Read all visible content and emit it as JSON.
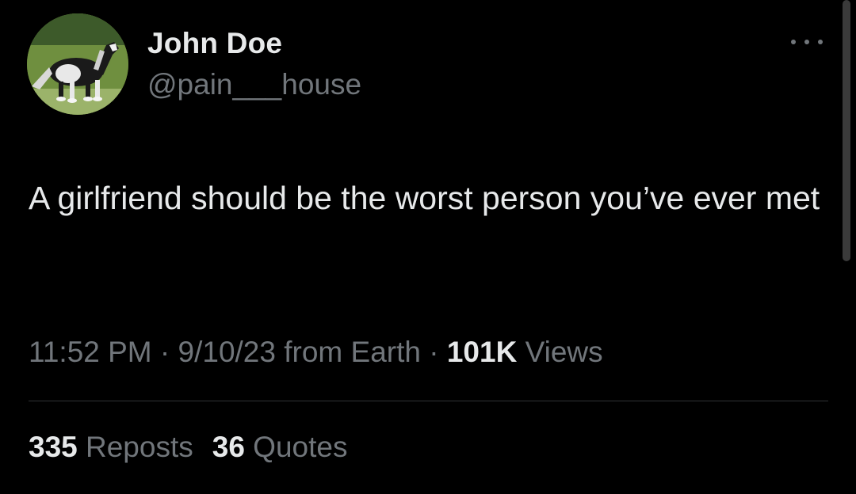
{
  "author": {
    "display_name": "John Doe",
    "handle": "@pain___house",
    "avatar_icon": "horse-avatar-icon"
  },
  "tweet": {
    "text": "A girlfriend should be the worst person you’ve ever met"
  },
  "meta": {
    "time": "11:52 PM",
    "separator1": " · ",
    "date": "9/10/23",
    "source": " from Earth",
    "separator2": " · ",
    "views_count": "101K",
    "views_label": " Views"
  },
  "stats": {
    "reposts_count": "335",
    "reposts_label": " Reposts",
    "quotes_count": "36",
    "quotes_label": " Quotes"
  },
  "more_icon": "more-horizontal-icon",
  "colors": {
    "background": "#000000",
    "primary_text": "#e7e9ea",
    "secondary_text": "#71767b",
    "divider": "#2f3336"
  }
}
